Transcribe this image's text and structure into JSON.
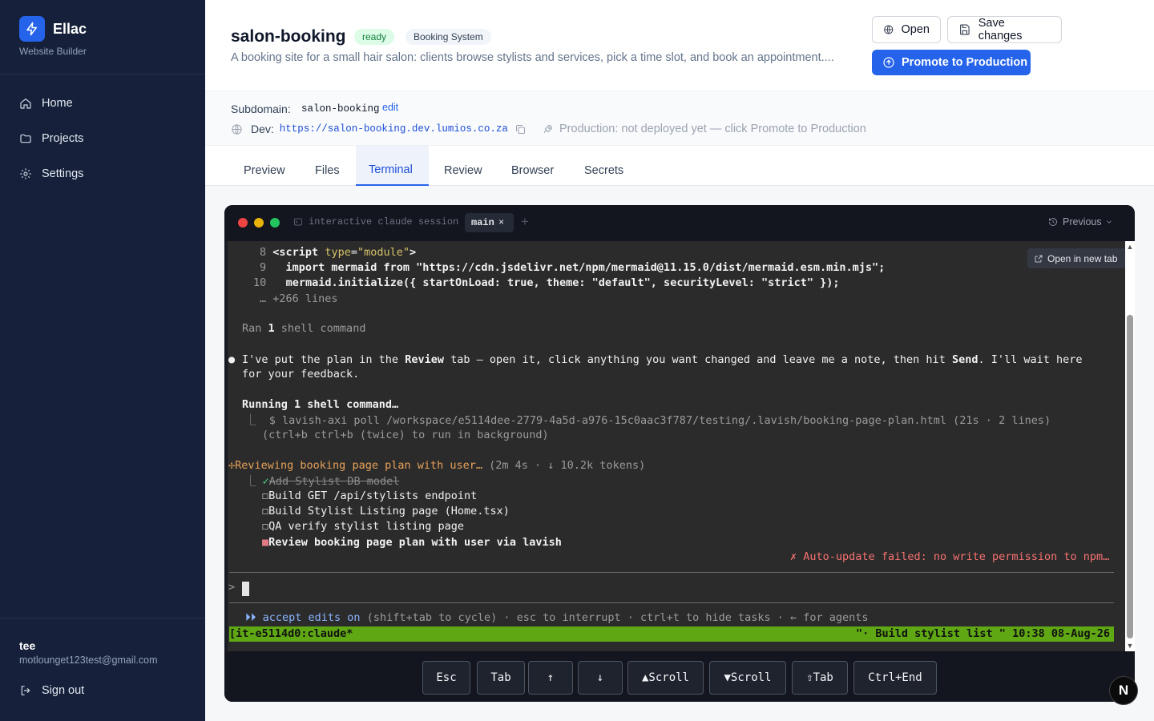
{
  "brand": {
    "name": "Ellac",
    "subtitle": "Website Builder"
  },
  "sidebar": {
    "items": [
      {
        "label": "Home",
        "icon": "home-icon"
      },
      {
        "label": "Projects",
        "icon": "folder-icon"
      },
      {
        "label": "Settings",
        "icon": "gear-icon"
      }
    ],
    "user": {
      "name": "tee",
      "email": "motlounget123test@gmail.com"
    },
    "signout_label": "Sign out"
  },
  "project": {
    "title": "salon-booking",
    "status": "ready",
    "type": "Booking System",
    "description": "A booking site for a small hair salon: clients browse stylists and services, pick a time slot, and book an appointment...."
  },
  "actions": {
    "open_label": "Open",
    "save_label": "Save changes",
    "promote_label": "Promote to Production"
  },
  "info": {
    "subdomain_label": "Subdomain:",
    "subdomain_value": "salon-booking",
    "edit_label": "edit",
    "dev_label": "Dev:",
    "dev_url": "https://salon-booking.dev.lumios.co.za",
    "production_text": "Production: not deployed yet — click Promote to Production"
  },
  "tabs": [
    {
      "label": "Preview",
      "active": false
    },
    {
      "label": "Files",
      "active": false
    },
    {
      "label": "Terminal",
      "active": true
    },
    {
      "label": "Review",
      "active": false
    },
    {
      "label": "Browser",
      "active": false
    },
    {
      "label": "Secrets",
      "active": false
    }
  ],
  "terminal": {
    "session_label": "interactive claude session",
    "tab_name": "main",
    "tab_close": "×",
    "add_tab": "+",
    "previous_label": "Previous",
    "open_new_tab_label": "Open in new tab",
    "lines": {
      "l8_num": "8",
      "l8_a": "<script ",
      "l8_attr": "type",
      "l8_eq": "=",
      "l8_val": "\"module\"",
      "l8_end": ">",
      "l9_num": "9",
      "l9_text": "import mermaid from \"https://cdn.jsdelivr.net/npm/mermaid@11.15.0/dist/mermaid.esm.min.mjs\";",
      "l10_num": "10",
      "l10_text": "mermaid.initialize({ startOnLoad: true, theme: \"default\", securityLevel: \"strict\" });",
      "more_lines": "… +266 lines",
      "ran_a": "Ran ",
      "ran_n": "1",
      "ran_b": " shell command",
      "msg_bullet": "●",
      "msg_a": "I've put the plan in the ",
      "msg_review": "Review",
      "msg_b": " tab — open it, click anything you want changed and leave me a note, then hit ",
      "msg_send": "Send",
      "msg_c": ". I'll wait here",
      "msg_d": "for your feedback.",
      "running_a": "Running ",
      "running_n": "1",
      "running_b": " shell command…",
      "cmd_prefix": "⎿",
      "cmd": "$ lavish-axi poll /workspace/e5114dee-2779-4a5d-a976-15c0aac3f787/testing/.lavish/booking-page-plan.html (21s · 2 lines)",
      "cmd_hint": "(ctrl+b ctrl+b (twice) to run in background)",
      "review_star": "✢",
      "review_text": "Reviewing booking page plan with user…",
      "review_meta": "(2m 4s · ↓ 10.2k tokens)",
      "task_prefix": "⎿",
      "task_done_mark": "✓",
      "task1": "Add Stylist DB model",
      "task_box": "☐",
      "task2": "Build GET /api/stylists endpoint",
      "task3": "Build Stylist Listing page (Home.tsx)",
      "task4": "QA verify stylist listing page",
      "task_active_mark": "■",
      "task5": "Review booking page plan with user via lavish",
      "error_mark": "✗",
      "error": "Auto-update failed: no write permission to npm…",
      "prompt": ">",
      "mode_arrows": "⏵⏵",
      "mode_a": "accept edits on",
      "mode_b": " (shift+tab to cycle) · esc to interrupt · ctrl+t to hide tasks · ← for agents",
      "status_left": "[it-e5114d0:claude*",
      "status_right": "\"· Build stylist list \" 10:38 08-Aug-26"
    },
    "keys": [
      "Esc",
      "Tab",
      "↑",
      "↓",
      "▲Scroll",
      "▼Scroll",
      "⇧Tab",
      "Ctrl+End"
    ]
  },
  "floating_badge": "N",
  "colors": {
    "accent": "#2563eb",
    "sidebar": "#16203a",
    "tmux_status": "#5fa814"
  }
}
